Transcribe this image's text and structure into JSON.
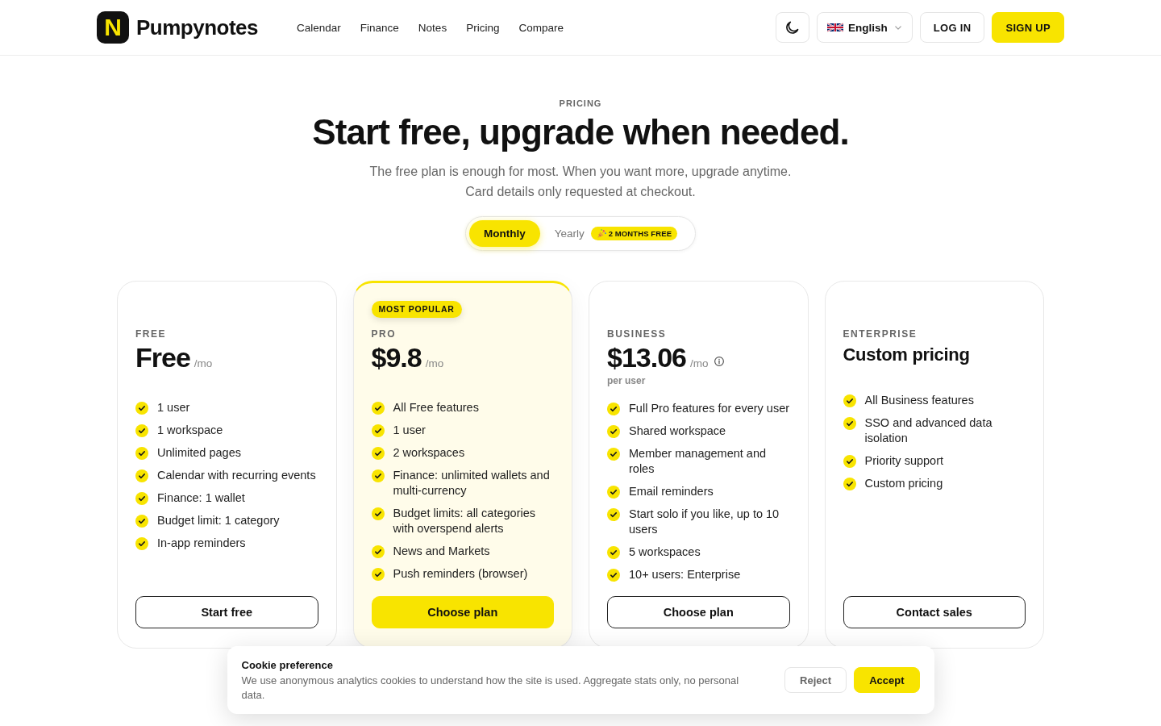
{
  "header": {
    "logo": {
      "mark": "N",
      "name": "Pumpynotes"
    },
    "nav": [
      "Calendar",
      "Finance",
      "Notes",
      "Pricing",
      "Compare"
    ],
    "language": "English",
    "actions": [
      {
        "label": "LOG IN",
        "kind": "outline"
      },
      {
        "label": "SIGN UP",
        "kind": "primary"
      }
    ]
  },
  "hero": {
    "eyebrow": "PRICING",
    "title": "Start free, upgrade when needed.",
    "subtitle": "The free plan is enough for most. When you want more, upgrade anytime. Card details only requested at checkout."
  },
  "billing_toggle": {
    "options": [
      {
        "label": "Monthly",
        "selected": true
      },
      {
        "label": "Yearly",
        "selected": false,
        "badge": "2 MONTHS FREE"
      }
    ]
  },
  "plans": [
    {
      "kind": "price",
      "featured": false,
      "tier": "FREE",
      "price": "Free",
      "unit": "/mo",
      "features": [
        "1 user",
        "1 workspace",
        "Unlimited pages",
        "Calendar with recurring events",
        "Finance: 1 wallet",
        "Budget limit: 1 category",
        "In-app reminders"
      ],
      "button": "Start free"
    },
    {
      "kind": "price",
      "featured": true,
      "badge": "MOST POPULAR",
      "tier": "PRO",
      "price": "$9.8",
      "unit": "/mo",
      "features": [
        "All Free features",
        "1 user",
        "2 workspaces",
        "Finance: unlimited wallets and multi-currency",
        "Budget limits: all categories with overspend alerts",
        "News and Markets",
        "Push reminders (browser)"
      ],
      "button": "Choose plan"
    },
    {
      "kind": "price",
      "featured": false,
      "tier": "BUSINESS",
      "price": "$13.06",
      "unit": "/mo",
      "info_icon": true,
      "note": "per user",
      "features": [
        "Full Pro features for every user",
        "Shared workspace",
        "Member management and roles",
        "Email reminders",
        "Start solo if you like, up to 10 users",
        "5 workspaces",
        "10+ users: Enterprise"
      ],
      "button": "Choose plan"
    },
    {
      "kind": "custom",
      "featured": false,
      "tier": "ENTERPRISE",
      "price": "Custom pricing",
      "features": [
        "All Business features",
        "SSO and advanced data isolation",
        "Priority support",
        "Custom pricing"
      ],
      "button": "Contact sales"
    }
  ],
  "cookie_banner": {
    "title": "Cookie preference",
    "text": "We use anonymous analytics cookies to understand how the site is used. Aggregate stats only, no personal data.",
    "buttons": [
      {
        "label": "Reject",
        "kind": "secondary"
      },
      {
        "label": "Accept",
        "kind": "primary"
      }
    ]
  }
}
